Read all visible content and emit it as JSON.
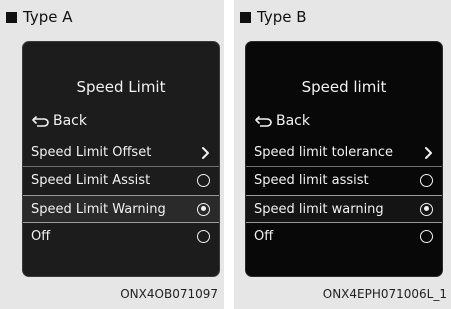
{
  "panels": [
    {
      "type_label": "Type A",
      "title": "Speed Limit",
      "back_label": "Back",
      "items": [
        {
          "label": "Speed Limit Offset",
          "control": "chevron"
        },
        {
          "label": "Speed Limit Assist",
          "control": "radio",
          "checked": false
        },
        {
          "label": "Speed Limit Warning",
          "control": "radio",
          "checked": true
        },
        {
          "label": "Off",
          "control": "radio",
          "checked": false
        }
      ],
      "caption": "ONX4OB071097"
    },
    {
      "type_label": "Type B",
      "title": "Speed limit",
      "back_label": "Back",
      "items": [
        {
          "label": "Speed limit tolerance",
          "control": "chevron"
        },
        {
          "label": "Speed limit assist",
          "control": "radio",
          "checked": false
        },
        {
          "label": "Speed limit warning",
          "control": "radio",
          "checked": true
        },
        {
          "label": "Off",
          "control": "radio",
          "checked": false
        }
      ],
      "caption": "ONX4EPH071006L_1"
    }
  ],
  "colors": {
    "panel_bg": "#e6e6e6",
    "screen_a_bg": "#1c1c1c",
    "screen_b_bg": "#080808",
    "text_on_screen": "#f2f2f2"
  }
}
